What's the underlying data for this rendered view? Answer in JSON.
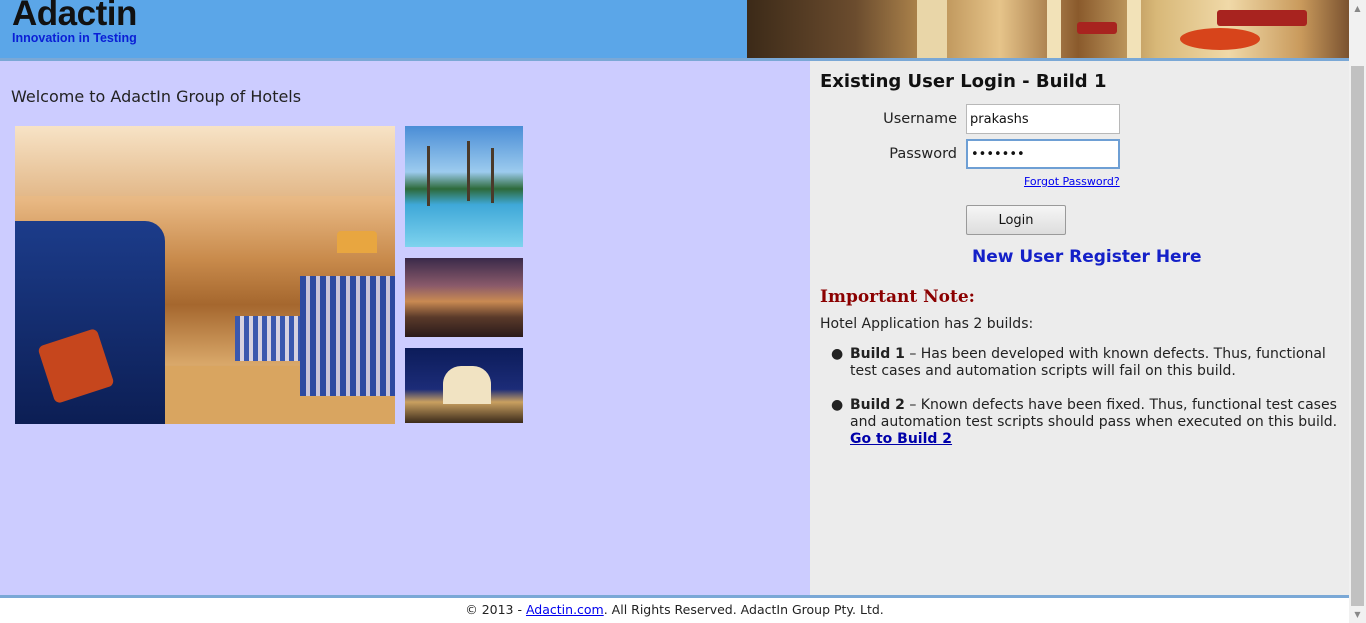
{
  "header": {
    "logo_word": "Adactin",
    "logo_tagline": "Innovation in Testing"
  },
  "main": {
    "welcome": "Welcome to AdactIn Group of Hotels"
  },
  "login": {
    "title": "Existing User Login - Build 1",
    "username_label": "Username",
    "username_value": "prakashs",
    "password_label": "Password",
    "password_value": "•••••••",
    "forgot_link": "Forgot Password?",
    "login_button": "Login",
    "register_link": "New User Register Here"
  },
  "note": {
    "title": "Important Note:",
    "intro": "Hotel Application has 2 builds:",
    "builds": [
      {
        "label": "Build 1",
        "text": " – Has been developed with known defects. Thus, functional test cases and automation scripts will fail on this build."
      },
      {
        "label": "Build 2",
        "text": " – Known defects have been fixed. Thus, functional test cases and automation test scripts should pass when executed on this build.",
        "link": "Go to Build 2"
      }
    ]
  },
  "footer": {
    "prefix": "© 2013 - ",
    "link": "Adactin.com",
    "suffix": ". All Rights Reserved. AdactIn Group Pty. Ltd."
  }
}
